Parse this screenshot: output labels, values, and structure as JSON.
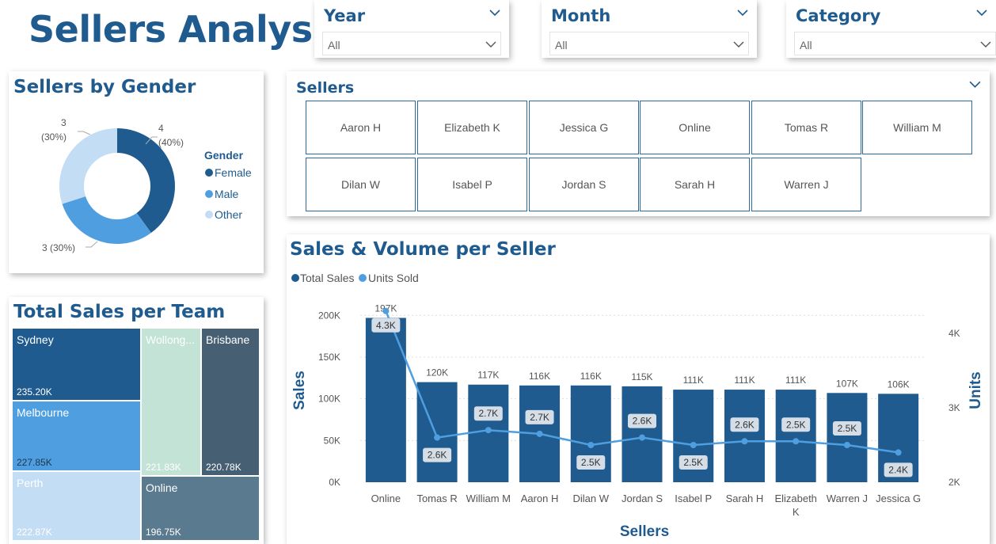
{
  "page": {
    "title": "Sellers Analysis"
  },
  "colors": {
    "dark": "#1f5b8e",
    "mid": "#4f9fe0",
    "light": "#c3ddf5",
    "mint": "#c2e3d6",
    "slate": "#475f73",
    "slate2": "#5a7a90"
  },
  "slicers": [
    {
      "title": "Year",
      "value": "All"
    },
    {
      "title": "Month",
      "value": "All"
    },
    {
      "title": "Category",
      "value": "All"
    }
  ],
  "gender": {
    "title": "Sellers by Gender",
    "legend_title": "Gender",
    "legend": [
      "Female",
      "Male",
      "Other"
    ],
    "labels": [
      {
        "line1": "4",
        "line2": "(40%)"
      },
      {
        "line1": "3 (30%)",
        "line2": ""
      },
      {
        "line1": "3",
        "line2": "(30%)"
      }
    ]
  },
  "sellers_slicer": {
    "title": "Sellers",
    "items": [
      "Aaron H",
      "Elizabeth K",
      "Jessica G",
      "Online",
      "Tomas R",
      "William M",
      "Dilan W",
      "Isabel P",
      "Jordan S",
      "Sarah H",
      "Warren J"
    ]
  },
  "team": {
    "title": "Total Sales per Team",
    "cells": [
      {
        "name": "Sydney",
        "value": "235.20K"
      },
      {
        "name": "Melbourne",
        "value": "227.85K"
      },
      {
        "name": "Perth",
        "value": "222.87K"
      },
      {
        "name": "Wollong...",
        "value": "221.83K"
      },
      {
        "name": "Brisbane",
        "value": "220.78K"
      },
      {
        "name": "Online",
        "value": "196.75K"
      }
    ]
  },
  "chart_data": {
    "type": "bar",
    "title": "Sales & Volume per Seller",
    "xlabel": "Sellers",
    "ylabel": "Sales",
    "y2label": "Units",
    "legend": [
      "Total Sales",
      "Units Sold"
    ],
    "legend_position": "top-left",
    "categories": [
      "Online",
      "Tomas R",
      "William M",
      "Aaron H",
      "Dilan W",
      "Jordan S",
      "Isabel P",
      "Sarah H",
      "Elizabeth K",
      "Warren J",
      "Jessica G"
    ],
    "series": [
      {
        "name": "Total Sales",
        "values": [
          197000,
          120000,
          117000,
          116000,
          116000,
          115000,
          111000,
          111000,
          111000,
          107000,
          106000
        ],
        "labels": [
          "197K",
          "120K",
          "117K",
          "116K",
          "116K",
          "115K",
          "111K",
          "111K",
          "111K",
          "107K",
          "106K"
        ]
      },
      {
        "name": "Units Sold",
        "values": [
          4300,
          2600,
          2700,
          2650,
          2500,
          2600,
          2500,
          2550,
          2550,
          2500,
          2400
        ],
        "labels": [
          "4.3K",
          "2.6K",
          "2.7K",
          "2.7K",
          "2.5K",
          "2.6K",
          "2.5K",
          "2.6K",
          "2.5K",
          "2.5K",
          "2.4K"
        ]
      }
    ],
    "ylim": [
      0,
      200000
    ],
    "y2lim": [
      2000,
      4000
    ],
    "yticks": [
      "0K",
      "50K",
      "100K",
      "150K",
      "200K"
    ],
    "y2ticks": [
      "2K",
      "3K",
      "4K"
    ],
    "grid": true
  }
}
